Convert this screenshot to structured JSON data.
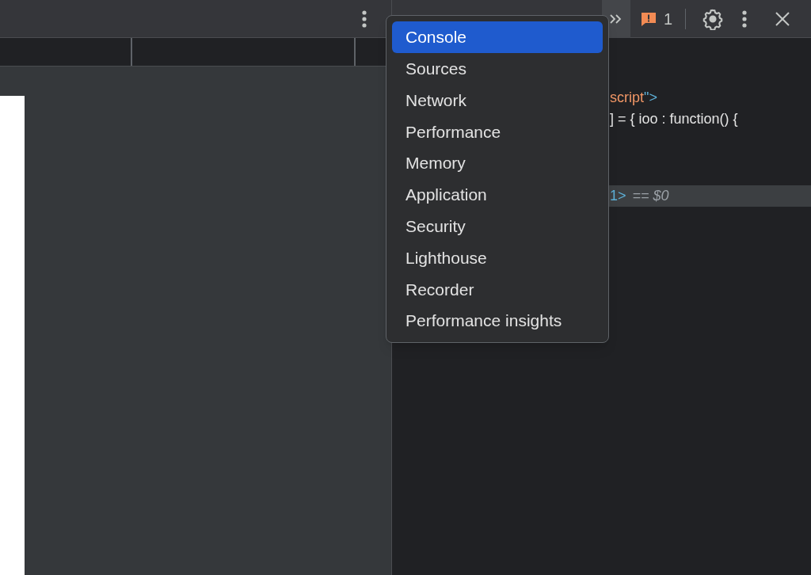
{
  "devtools_toolbar": {
    "issues_count": "1"
  },
  "code_lines": [
    {
      "selected": false,
      "segments": [
        {
          "kind": "tag",
          "text": "script"
        },
        {
          "kind": "punct",
          "text": "\">"
        }
      ]
    },
    {
      "selected": false,
      "segments": [
        {
          "kind": "plain",
          "text": "] = { ioo : function() {"
        }
      ]
    },
    {
      "selected": true,
      "segments": [
        {
          "kind": "punct",
          "text": "1>"
        },
        {
          "kind": "ref",
          "text": "== $0"
        }
      ]
    }
  ],
  "panel_menu": {
    "items": [
      {
        "label": "Console",
        "selected": true
      },
      {
        "label": "Sources",
        "selected": false
      },
      {
        "label": "Network",
        "selected": false
      },
      {
        "label": "Performance",
        "selected": false
      },
      {
        "label": "Memory",
        "selected": false
      },
      {
        "label": "Application",
        "selected": false
      },
      {
        "label": "Security",
        "selected": false
      },
      {
        "label": "Lighthouse",
        "selected": false
      },
      {
        "label": "Recorder",
        "selected": false
      },
      {
        "label": "Performance insights",
        "selected": false
      }
    ]
  }
}
